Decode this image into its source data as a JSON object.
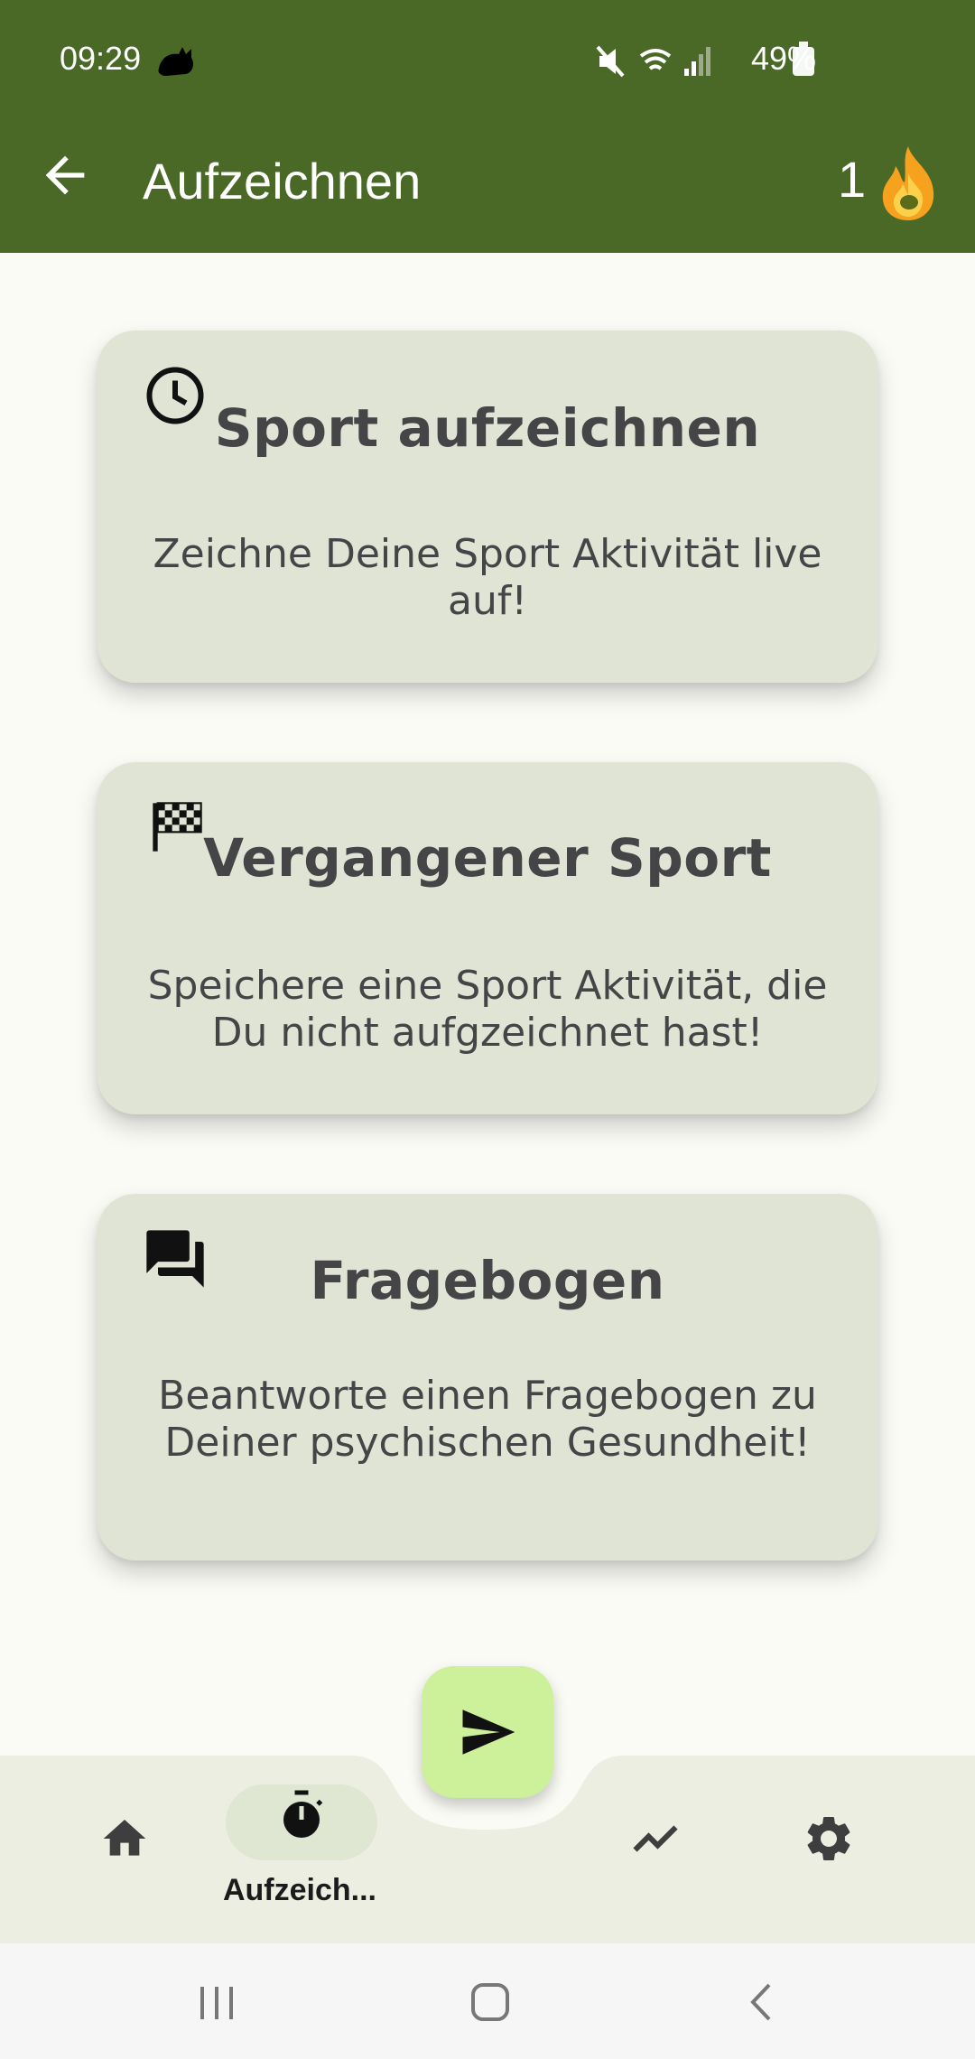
{
  "status_bar": {
    "time": "09:29",
    "battery": "49%"
  },
  "app_bar": {
    "title": "Aufzeichnen",
    "streak_count": "1",
    "back_icon": "arrow-back-icon",
    "streak_icon": "flame-icon"
  },
  "cards": [
    {
      "icon": "clock-icon",
      "title": "Sport aufzeichnen",
      "description": "Zeichne Deine Sport Aktivität live auf!"
    },
    {
      "icon": "checkered-flag-icon",
      "title": "Vergangener Sport",
      "description": "Speichere eine Sport Aktivität, die Du nicht aufgzeichnet hast!"
    },
    {
      "icon": "question-answer-icon",
      "title": "Fragebogen",
      "description": "Beantworte einen Fragebogen zu Deiner psychischen Gesundheit!"
    }
  ],
  "fab": {
    "icon": "send-icon"
  },
  "bottom_nav": {
    "items": [
      {
        "icon": "home-icon",
        "label": ""
      },
      {
        "icon": "timer-icon",
        "label": "Aufzeich...",
        "selected": true
      },
      {
        "icon": "trending-up-icon",
        "label": ""
      },
      {
        "icon": "settings-icon",
        "label": ""
      }
    ]
  },
  "colors": {
    "primary": "#4a6926",
    "card_background": "#e0e4d4",
    "fab_background": "#cdf09a",
    "page_background": "#fbfbf6"
  }
}
